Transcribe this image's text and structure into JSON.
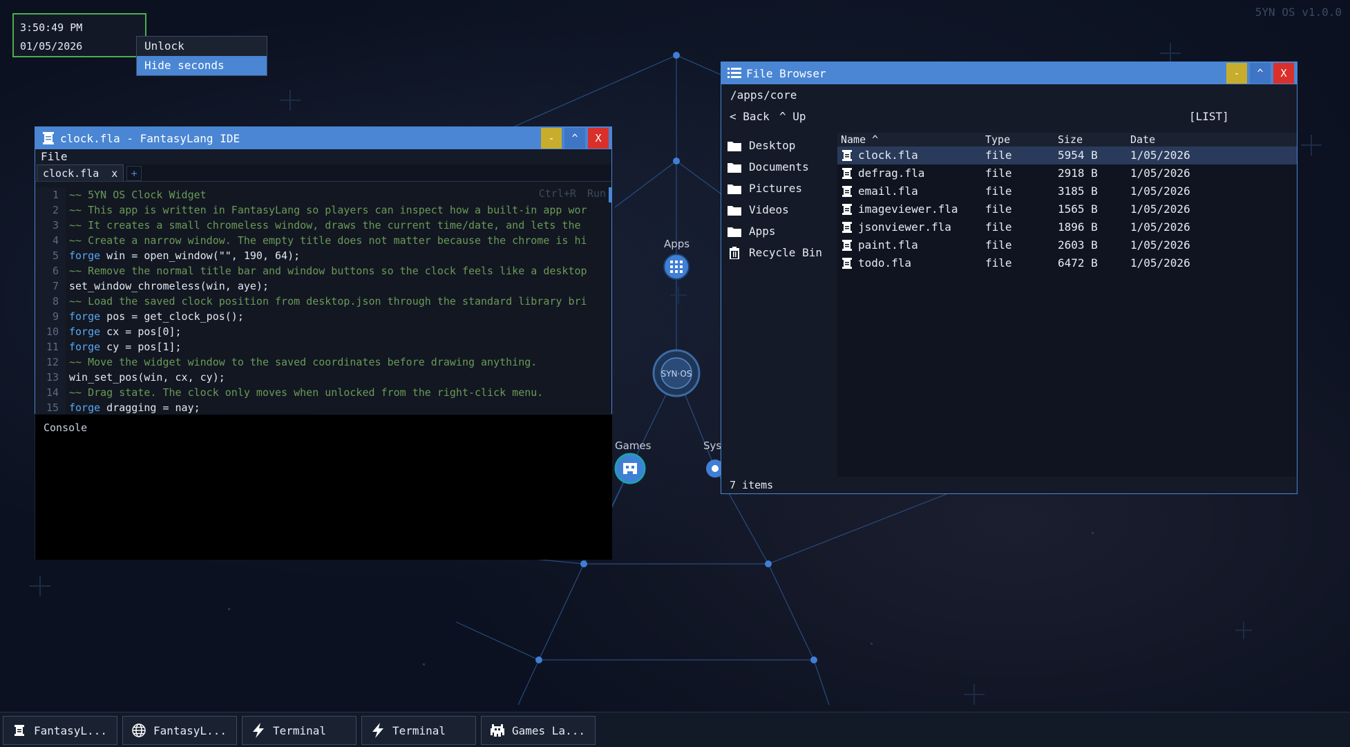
{
  "os_version": "5YN OS v1.0.0",
  "clock": {
    "time": "3:50:49 PM",
    "date": "01/05/2026"
  },
  "context_menu": {
    "items": [
      {
        "label": "Unlock"
      },
      {
        "label": "Hide seconds"
      }
    ]
  },
  "desktop_nodes": [
    {
      "label": "Apps"
    },
    {
      "label": "Games"
    },
    {
      "label": "Sys"
    }
  ],
  "ide": {
    "title": "clock.fla - FantasyLang IDE",
    "menu": {
      "file": "File"
    },
    "tab": {
      "label": "clock.fla",
      "close": "x",
      "add": "+"
    },
    "hint": {
      "shortcut": "Ctrl+R",
      "action": "Run"
    },
    "lines": [
      {
        "n": "1",
        "text": "~~ 5YN OS Clock Widget",
        "type": "comment"
      },
      {
        "n": "2",
        "text": "~~ This app is written in FantasyLang so players can inspect how a built-in app wor",
        "type": "comment"
      },
      {
        "n": "3",
        "text": "~~ It creates a small chromeless window, draws the current time/date, and lets the ",
        "type": "comment"
      },
      {
        "n": "4",
        "text": "~~ Create a narrow window. The empty title does not matter because the chrome is hi",
        "type": "comment"
      },
      {
        "n": "5",
        "kw": "forge",
        "text": " win = open_window(\"\", 190, 64);",
        "type": "code"
      },
      {
        "n": "6",
        "text": "~~ Remove the normal title bar and window buttons so the clock feels like a desktop",
        "type": "comment"
      },
      {
        "n": "7",
        "text": "set_window_chromeless(win, aye);",
        "type": "code"
      },
      {
        "n": "8",
        "text": "~~ Load the saved clock position from desktop.json through the standard library bri",
        "type": "comment"
      },
      {
        "n": "9",
        "kw": "forge",
        "text": " pos = get_clock_pos();",
        "type": "code"
      },
      {
        "n": "10",
        "kw": "forge",
        "text": " cx = pos[0];",
        "type": "code"
      },
      {
        "n": "11",
        "kw": "forge",
        "text": " cy = pos[1];",
        "type": "code"
      },
      {
        "n": "12",
        "text": "~~ Move the widget window to the saved coordinates before drawing anything.",
        "type": "comment"
      },
      {
        "n": "13",
        "text": "win_set_pos(win, cx, cy);",
        "type": "code"
      },
      {
        "n": "14",
        "text": "~~ Drag state. The clock only moves when unlocked from the right-click menu.",
        "type": "comment"
      },
      {
        "n": "15",
        "kw": "forge",
        "text": " dragging = nay;",
        "type": "code"
      }
    ],
    "console_label": "Console"
  },
  "file_browser": {
    "title": "File Browser",
    "path": "/apps/core",
    "nav": {
      "back": "< Back",
      "up": "^ Up",
      "view": "[LIST]"
    },
    "sidebar": [
      {
        "label": "Desktop",
        "icon": "folder-icon"
      },
      {
        "label": "Documents",
        "icon": "folder-icon"
      },
      {
        "label": "Pictures",
        "icon": "folder-icon"
      },
      {
        "label": "Videos",
        "icon": "folder-icon"
      },
      {
        "label": "Apps",
        "icon": "folder-icon"
      },
      {
        "label": "Recycle Bin",
        "icon": "trash-icon"
      }
    ],
    "columns": {
      "name": "Name ^",
      "type": "Type",
      "size": "Size",
      "date": "Date"
    },
    "files": [
      {
        "name": "clock.fla",
        "type": "file",
        "size": "5954 B",
        "date": "1/05/2026",
        "selected": true
      },
      {
        "name": "defrag.fla",
        "type": "file",
        "size": "2918 B",
        "date": "1/05/2026"
      },
      {
        "name": "email.fla",
        "type": "file",
        "size": "3185 B",
        "date": "1/05/2026"
      },
      {
        "name": "imageviewer.fla",
        "type": "file",
        "size": "1565 B",
        "date": "1/05/2026"
      },
      {
        "name": "jsonviewer.fla",
        "type": "file",
        "size": "1896 B",
        "date": "1/05/2026"
      },
      {
        "name": "paint.fla",
        "type": "file",
        "size": "2603 B",
        "date": "1/05/2026"
      },
      {
        "name": "todo.fla",
        "type": "file",
        "size": "6472 B",
        "date": "1/05/2026"
      }
    ],
    "status": "7 items"
  },
  "window_buttons": {
    "min": "-",
    "max": "^",
    "close": "X"
  },
  "taskbar": [
    {
      "label": "FantasyL...",
      "icon": "scroll-icon"
    },
    {
      "label": "FantasyL...",
      "icon": "globe-icon"
    },
    {
      "label": "Terminal",
      "icon": "lightning-icon"
    },
    {
      "label": "Terminal",
      "icon": "lightning-icon"
    },
    {
      "label": "Games La...",
      "icon": "invader-icon"
    }
  ],
  "colors": {
    "accent": "#4a86d4",
    "clock_border": "#4caf50",
    "minimize": "#c8ad2c",
    "close": "#d9302b",
    "comment": "#6a9a55",
    "keyword": "#5aa8ef"
  }
}
